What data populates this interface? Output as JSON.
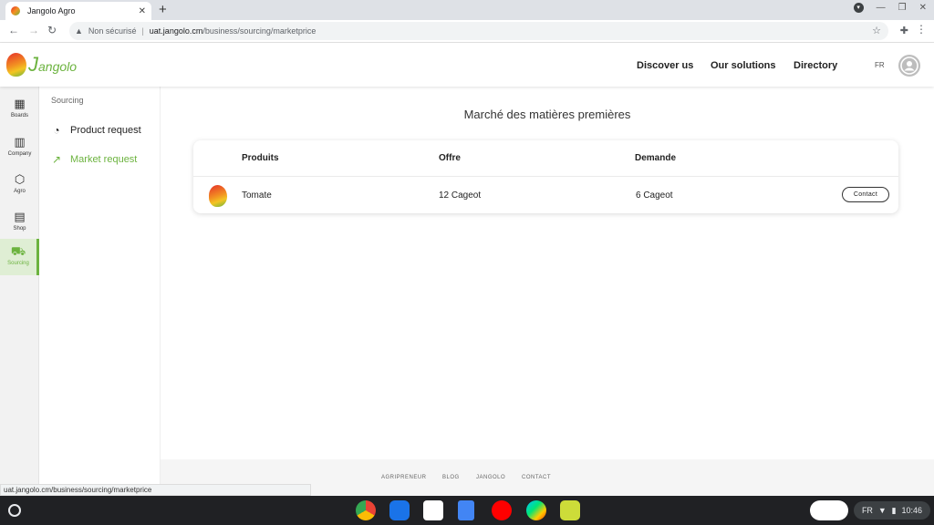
{
  "browser": {
    "tab_title": "Jangolo Agro",
    "tab_close": "✕",
    "new_tab": "+",
    "address_security": "Non sécurisé",
    "address_host": "uat.jangolo.cm",
    "address_path": "/business/sourcing/marketprice",
    "status_url": "uat.jangolo.cm/business/sourcing/marketprice"
  },
  "header": {
    "logo_text_first": "J",
    "logo_text_rest": "angolo",
    "nav": [
      "Discover us",
      "Our solutions",
      "Directory"
    ],
    "language": "FR"
  },
  "rail": [
    {
      "label": "Boards",
      "icon": "▦"
    },
    {
      "label": "Company",
      "icon": "▥"
    },
    {
      "label": "Agro",
      "icon": "⬡"
    },
    {
      "label": "Shop",
      "icon": "▤"
    },
    {
      "label": "Sourcing",
      "icon": "⛟"
    }
  ],
  "submenu": {
    "title": "Sourcing",
    "items": [
      {
        "label": "Product request",
        "icon": "◔"
      },
      {
        "label": "Market request",
        "icon": "↗"
      }
    ]
  },
  "main": {
    "title": "Marché des matières premières",
    "columns": [
      "Produits",
      "Offre",
      "Demande"
    ],
    "rows": [
      {
        "product": "Tomate",
        "offer": "12 Cageot",
        "demand": "6 Cageot",
        "action": "Contact"
      }
    ]
  },
  "footer": {
    "links": [
      "AGRIPRENEUR",
      "BLOG",
      "JANGOLO",
      "CONTACT"
    ]
  },
  "system": {
    "lang": "FR",
    "time": "10:46"
  },
  "colors": {
    "accent": "#6cb33f",
    "shelf": "#202124"
  }
}
